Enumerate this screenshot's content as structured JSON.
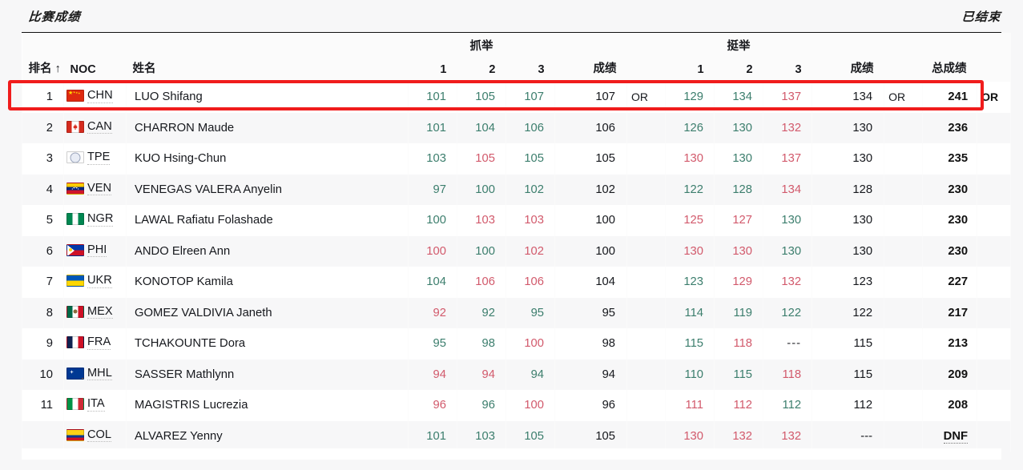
{
  "header": {
    "title": "比赛成绩",
    "status": "已结束"
  },
  "table": {
    "columns": {
      "rank": "排名 ↑",
      "noc": "NOC",
      "name": "姓名",
      "snatch_group": "抓举",
      "cleanjerk_group": "挺举",
      "attempt1": "1",
      "attempt2": "2",
      "attempt3": "3",
      "result": "成绩",
      "total": "总成绩"
    },
    "rows": [
      {
        "rank": "1",
        "noc": "CHN",
        "flag": "flag-cn",
        "name": "LUO Shifang",
        "snatch": [
          {
            "v": "101",
            "s": "good"
          },
          {
            "v": "105",
            "s": "good"
          },
          {
            "v": "107",
            "s": "good"
          }
        ],
        "snatch_result": "107",
        "snatch_record": "OR",
        "cj": [
          {
            "v": "129",
            "s": "good"
          },
          {
            "v": "134",
            "s": "good"
          },
          {
            "v": "137",
            "s": "bad"
          }
        ],
        "cj_result": "134",
        "cj_record": "OR",
        "total": "241",
        "total_record": "OR",
        "total_abbr": false
      },
      {
        "rank": "2",
        "noc": "CAN",
        "flag": "flag-ca",
        "name": "CHARRON Maude",
        "snatch": [
          {
            "v": "101",
            "s": "good"
          },
          {
            "v": "104",
            "s": "good"
          },
          {
            "v": "106",
            "s": "good"
          }
        ],
        "snatch_result": "106",
        "snatch_record": "",
        "cj": [
          {
            "v": "126",
            "s": "good"
          },
          {
            "v": "130",
            "s": "good"
          },
          {
            "v": "132",
            "s": "bad"
          }
        ],
        "cj_result": "130",
        "cj_record": "",
        "total": "236",
        "total_record": "",
        "total_abbr": false
      },
      {
        "rank": "3",
        "noc": "TPE",
        "flag": "flag-tw",
        "name": "KUO Hsing-Chun",
        "snatch": [
          {
            "v": "103",
            "s": "good"
          },
          {
            "v": "105",
            "s": "bad"
          },
          {
            "v": "105",
            "s": "good"
          }
        ],
        "snatch_result": "105",
        "snatch_record": "",
        "cj": [
          {
            "v": "130",
            "s": "bad"
          },
          {
            "v": "130",
            "s": "good"
          },
          {
            "v": "137",
            "s": "bad"
          }
        ],
        "cj_result": "130",
        "cj_record": "",
        "total": "235",
        "total_record": "",
        "total_abbr": false
      },
      {
        "rank": "4",
        "noc": "VEN",
        "flag": "flag-ve",
        "name": "VENEGAS VALERA Anyelin",
        "snatch": [
          {
            "v": "97",
            "s": "good"
          },
          {
            "v": "100",
            "s": "good"
          },
          {
            "v": "102",
            "s": "good"
          }
        ],
        "snatch_result": "102",
        "snatch_record": "",
        "cj": [
          {
            "v": "122",
            "s": "good"
          },
          {
            "v": "128",
            "s": "good"
          },
          {
            "v": "134",
            "s": "bad"
          }
        ],
        "cj_result": "128",
        "cj_record": "",
        "total": "230",
        "total_record": "",
        "total_abbr": false
      },
      {
        "rank": "5",
        "noc": "NGR",
        "flag": "flag-ng",
        "name": "LAWAL Rafiatu Folashade",
        "snatch": [
          {
            "v": "100",
            "s": "good"
          },
          {
            "v": "103",
            "s": "bad"
          },
          {
            "v": "103",
            "s": "bad"
          }
        ],
        "snatch_result": "100",
        "snatch_record": "",
        "cj": [
          {
            "v": "125",
            "s": "bad"
          },
          {
            "v": "127",
            "s": "bad"
          },
          {
            "v": "130",
            "s": "good"
          }
        ],
        "cj_result": "130",
        "cj_record": "",
        "total": "230",
        "total_record": "",
        "total_abbr": false
      },
      {
        "rank": "6",
        "noc": "PHI",
        "flag": "flag-ph",
        "name": "ANDO Elreen Ann",
        "snatch": [
          {
            "v": "100",
            "s": "bad"
          },
          {
            "v": "100",
            "s": "good"
          },
          {
            "v": "102",
            "s": "bad"
          }
        ],
        "snatch_result": "100",
        "snatch_record": "",
        "cj": [
          {
            "v": "130",
            "s": "bad"
          },
          {
            "v": "130",
            "s": "bad"
          },
          {
            "v": "130",
            "s": "good"
          }
        ],
        "cj_result": "130",
        "cj_record": "",
        "total": "230",
        "total_record": "",
        "total_abbr": false
      },
      {
        "rank": "7",
        "noc": "UKR",
        "flag": "flag-ua",
        "name": "KONOTOP Kamila",
        "snatch": [
          {
            "v": "104",
            "s": "good"
          },
          {
            "v": "106",
            "s": "bad"
          },
          {
            "v": "106",
            "s": "bad"
          }
        ],
        "snatch_result": "104",
        "snatch_record": "",
        "cj": [
          {
            "v": "123",
            "s": "good"
          },
          {
            "v": "129",
            "s": "bad"
          },
          {
            "v": "132",
            "s": "bad"
          }
        ],
        "cj_result": "123",
        "cj_record": "",
        "total": "227",
        "total_record": "",
        "total_abbr": false
      },
      {
        "rank": "8",
        "noc": "MEX",
        "flag": "flag-mx",
        "name": "GOMEZ VALDIVIA Janeth",
        "snatch": [
          {
            "v": "92",
            "s": "bad"
          },
          {
            "v": "92",
            "s": "good"
          },
          {
            "v": "95",
            "s": "good"
          }
        ],
        "snatch_result": "95",
        "snatch_record": "",
        "cj": [
          {
            "v": "114",
            "s": "good"
          },
          {
            "v": "119",
            "s": "good"
          },
          {
            "v": "122",
            "s": "good"
          }
        ],
        "cj_result": "122",
        "cj_record": "",
        "total": "217",
        "total_record": "",
        "total_abbr": false
      },
      {
        "rank": "9",
        "noc": "FRA",
        "flag": "flag-fr",
        "name": "TCHAKOUNTE Dora",
        "snatch": [
          {
            "v": "95",
            "s": "good"
          },
          {
            "v": "98",
            "s": "good"
          },
          {
            "v": "100",
            "s": "bad"
          }
        ],
        "snatch_result": "98",
        "snatch_record": "",
        "cj": [
          {
            "v": "115",
            "s": "good"
          },
          {
            "v": "118",
            "s": "bad"
          },
          {
            "v": "---",
            "s": "none"
          }
        ],
        "cj_result": "115",
        "cj_record": "",
        "total": "213",
        "total_record": "",
        "total_abbr": false
      },
      {
        "rank": "10",
        "noc": "MHL",
        "flag": "flag-mh",
        "name": "SASSER Mathlynn",
        "snatch": [
          {
            "v": "94",
            "s": "bad"
          },
          {
            "v": "94",
            "s": "bad"
          },
          {
            "v": "94",
            "s": "good"
          }
        ],
        "snatch_result": "94",
        "snatch_record": "",
        "cj": [
          {
            "v": "110",
            "s": "good"
          },
          {
            "v": "115",
            "s": "good"
          },
          {
            "v": "118",
            "s": "bad"
          }
        ],
        "cj_result": "115",
        "cj_record": "",
        "total": "209",
        "total_record": "",
        "total_abbr": false
      },
      {
        "rank": "11",
        "noc": "ITA",
        "flag": "flag-it",
        "name": "MAGISTRIS Lucrezia",
        "snatch": [
          {
            "v": "96",
            "s": "bad"
          },
          {
            "v": "96",
            "s": "good"
          },
          {
            "v": "100",
            "s": "bad"
          }
        ],
        "snatch_result": "96",
        "snatch_record": "",
        "cj": [
          {
            "v": "111",
            "s": "bad"
          },
          {
            "v": "112",
            "s": "bad"
          },
          {
            "v": "112",
            "s": "good"
          }
        ],
        "cj_result": "112",
        "cj_record": "",
        "total": "208",
        "total_record": "",
        "total_abbr": false
      },
      {
        "rank": "",
        "noc": "COL",
        "flag": "flag-co",
        "name": "ALVAREZ Yenny",
        "snatch": [
          {
            "v": "101",
            "s": "good"
          },
          {
            "v": "103",
            "s": "good"
          },
          {
            "v": "105",
            "s": "good"
          }
        ],
        "snatch_result": "105",
        "snatch_record": "",
        "cj": [
          {
            "v": "130",
            "s": "bad"
          },
          {
            "v": "132",
            "s": "bad"
          },
          {
            "v": "132",
            "s": "bad"
          }
        ],
        "cj_result": "---",
        "cj_record": "",
        "total": "DNF",
        "total_record": "",
        "total_abbr": true
      }
    ]
  },
  "colors": {
    "good": "#3c7e6d",
    "bad": "#d25a6c",
    "highlight": "#f01c1c",
    "text": "#16181d"
  }
}
